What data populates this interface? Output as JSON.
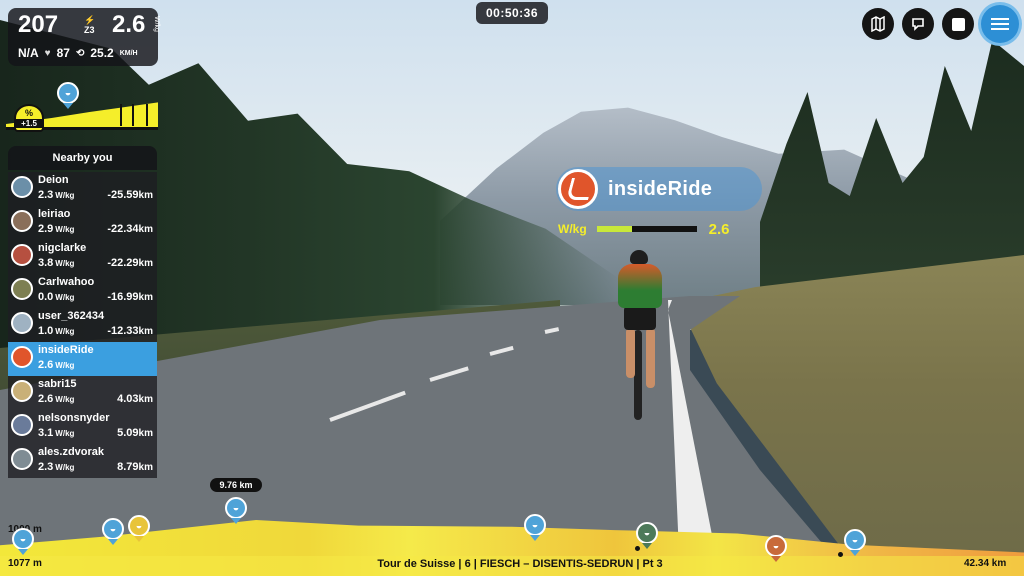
{
  "stats": {
    "power": "207",
    "zone_label": "Z3",
    "wkg": "2.6",
    "wkg_unit": "W/kg",
    "heart_rate": "N/A",
    "cadence": "87",
    "speed": "25.2",
    "speed_unit": "KM/H"
  },
  "timer": "00:50:36",
  "gradient": {
    "percent_symbol": "%",
    "value": "+1.5"
  },
  "nearby": {
    "title": "Nearby you",
    "riders": [
      {
        "name": "Deion",
        "wkg": "2.3",
        "unit": "W/kg",
        "dist": "-25.59",
        "km": "km",
        "me": false
      },
      {
        "name": "leiriao",
        "wkg": "2.9",
        "unit": "W/kg",
        "dist": "-22.34",
        "km": "km",
        "me": false
      },
      {
        "name": "nigclarke",
        "wkg": "3.8",
        "unit": "W/kg",
        "dist": "-22.29",
        "km": "km",
        "me": false
      },
      {
        "name": "Carlwahoo",
        "wkg": "0.0",
        "unit": "W/kg",
        "dist": "-16.99",
        "km": "km",
        "me": false
      },
      {
        "name": "user_362434",
        "wkg": "1.0",
        "unit": "W/kg",
        "dist": "-12.33",
        "km": "km",
        "me": false
      },
      {
        "name": "insideRide",
        "wkg": "2.6",
        "unit": "W/kg",
        "dist": "",
        "km": "",
        "me": true
      },
      {
        "name": "sabri15",
        "wkg": "2.6",
        "unit": "W/kg",
        "dist": "4.03",
        "km": "km",
        "me": false
      },
      {
        "name": "nelsonsnyder",
        "wkg": "3.1",
        "unit": "W/kg",
        "dist": "5.09",
        "km": "km",
        "me": false
      },
      {
        "name": "ales.zdvorak",
        "wkg": "2.3",
        "unit": "W/kg",
        "dist": "8.79",
        "km": "km",
        "me": false
      }
    ]
  },
  "rider_overlay": {
    "name": "insideRide",
    "label": "W/kg",
    "value": "2.6",
    "fill_fraction": 0.35
  },
  "elevation": {
    "start_elev": "1077 m",
    "top_elev": "1000 m",
    "route": "Tour de Suisse | 6 | FIESCH – DISENTIS-SEDRUN | Pt 3",
    "total_distance": "42.34 km",
    "distance_flag": "9.76 km"
  },
  "icons": {
    "map": "map-icon",
    "loop": "route-loop-icon",
    "stop": "stop-icon",
    "menu": "menu-icon"
  },
  "colors": {
    "accent": "#3b9fe0",
    "highlight": "#f5ee2a",
    "panel": "#141418"
  }
}
